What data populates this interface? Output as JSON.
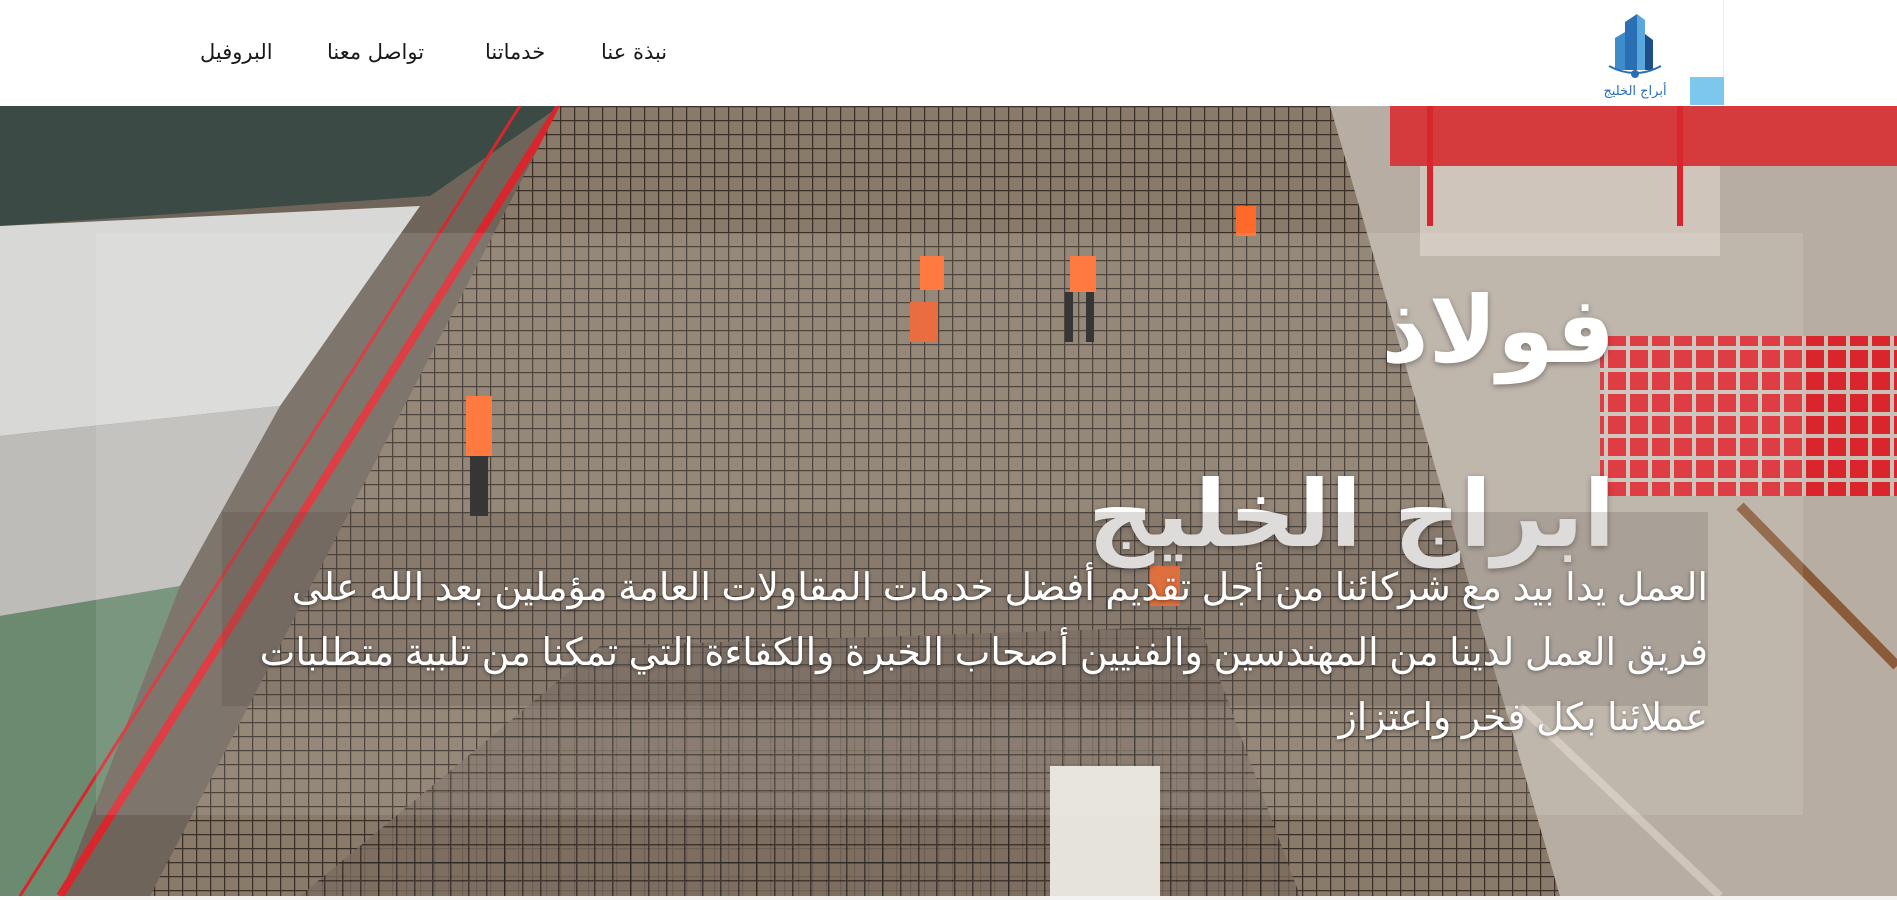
{
  "header": {
    "logo_text": "أبراج الخليج",
    "nav": [
      {
        "label": "نبذة عنا"
      },
      {
        "label": "خدماتنا"
      },
      {
        "label": "تواصل معنا"
      },
      {
        "label": "البروفيل"
      }
    ]
  },
  "hero": {
    "title": "فولاذ",
    "subtitle": "ابراج الخليج",
    "description": "العمل يدا بيد مع شركائنا من أجل تقديم أفضل خدمات المقاولات العامة مؤملين بعد الله على فريق العمل لدينا من المهندسين والفنيين أصحاب الخبرة والكفاءة التي تمكنا من تلبية متطلبات عملائنا بكل فخر واعتزاز"
  },
  "colors": {
    "accent": "#7cc7ee",
    "logo_blue": "#2a6fb4",
    "scaffold_red": "#d9262c",
    "hero_text": "#ffffff"
  }
}
